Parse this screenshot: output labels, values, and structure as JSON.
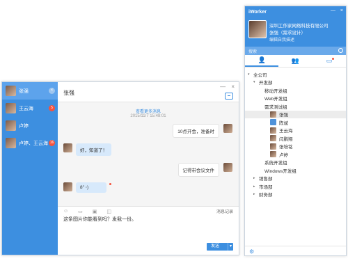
{
  "chat": {
    "window_controls": [
      "—",
      "×"
    ],
    "contacts": [
      {
        "name": "张强",
        "badge": "",
        "active": true
      },
      {
        "name": "王云海",
        "badge": "5",
        "active": false
      },
      {
        "name": "卢婷",
        "badge": "",
        "active": false
      },
      {
        "name": "卢婷、王云海",
        "badge": "16",
        "active": false
      }
    ],
    "header_title": "张强",
    "history_link": "查看更多消息",
    "timestamp": "2015/11/7  15:48:01",
    "messages": [
      {
        "dir": "out",
        "text": "10点开会，准备时"
      },
      {
        "dir": "in",
        "text": "好，知道了！"
      },
      {
        "dir": "out",
        "text": "记得带会议文件"
      },
      {
        "dir": "in",
        "text": "8″  ◦)"
      }
    ],
    "toolbar": {
      "icons": [
        "emoji-icon",
        "folder-icon",
        "image-icon",
        "screenshot-icon"
      ],
      "history_label": "消息记录"
    },
    "input_text": "这条图片你能看到吗？发我一份。",
    "send_label": "发送",
    "send_dropdown": "▾"
  },
  "iworker": {
    "title": "iWorker",
    "window_controls": [
      "—",
      "×"
    ],
    "company": "深圳工作家网络科技有限公司",
    "user_name": "张强（需求设计）",
    "signature": "编辑自我描述",
    "search_placeholder": "搜索",
    "tree": [
      {
        "label": "全公司",
        "level": 0,
        "arrow": "▾"
      },
      {
        "label": "开发部",
        "level": 1,
        "arrow": "▾"
      },
      {
        "label": "移动开发组",
        "level": 2,
        "arrow": ""
      },
      {
        "label": "Web开发组",
        "level": 2,
        "arrow": ""
      },
      {
        "label": "需求测试组",
        "level": 2,
        "arrow": ""
      },
      {
        "label": "张强",
        "level": 3,
        "arrow": "",
        "avatar": true,
        "selected": true
      },
      {
        "label": "陈斌",
        "level": 3,
        "arrow": "",
        "avatar": "blue"
      },
      {
        "label": "王云海",
        "level": 3,
        "arrow": "",
        "avatar": true
      },
      {
        "label": "闫鹏翔",
        "level": 3,
        "arrow": "",
        "avatar": true
      },
      {
        "label": "张培铭",
        "level": 3,
        "arrow": "",
        "avatar": true
      },
      {
        "label": "卢婷",
        "level": 3,
        "arrow": "",
        "avatar": true
      },
      {
        "label": "系统开发组",
        "level": 2,
        "arrow": ""
      },
      {
        "label": "Windows开发组",
        "level": 2,
        "arrow": ""
      },
      {
        "label": "销售部",
        "level": 1,
        "arrow": "▸"
      },
      {
        "label": "市场部",
        "level": 1,
        "arrow": "▸"
      },
      {
        "label": "财务部",
        "level": 1,
        "arrow": "▸"
      }
    ]
  },
  "colors": {
    "accent": "#3d8fe0",
    "badge": "#f5533d",
    "bubble_in": "#d7e9fb"
  }
}
